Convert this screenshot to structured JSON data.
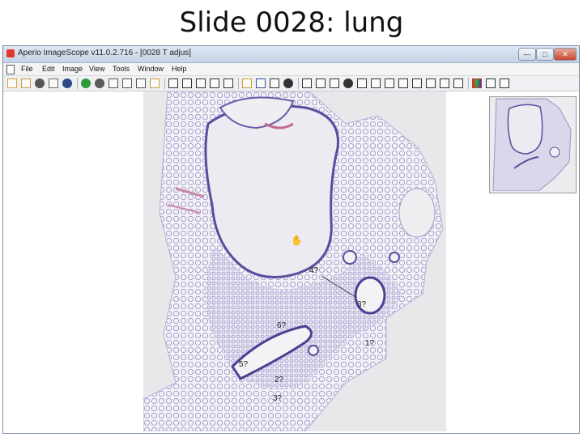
{
  "slide": {
    "title": "Slide 0028: lung"
  },
  "window": {
    "title": "Aperio ImageScope v11.0.2.716 - [0028 T adjus]",
    "buttons": {
      "minimize": "—",
      "maximize": "□",
      "close": "✕"
    }
  },
  "menu": {
    "items": [
      {
        "label": "File"
      },
      {
        "label": "Edit"
      },
      {
        "label": "Image"
      },
      {
        "label": "View"
      },
      {
        "label": "Tools"
      },
      {
        "label": "Window"
      },
      {
        "label": "Help"
      }
    ]
  },
  "toolbar": {
    "icons": [
      {
        "name": "open-folder-icon",
        "color": "#d9a63a"
      },
      {
        "name": "open-remote-icon",
        "color": "#c99a3a"
      },
      {
        "name": "camera-icon",
        "color": "#555555"
      },
      {
        "name": "print-icon",
        "color": "#666666"
      },
      {
        "name": "info-icon",
        "color": "#2b4a8a"
      },
      {
        "name": "go-back-icon",
        "color": "#2e9a3a"
      },
      {
        "name": "go-forward-icon",
        "color": "#5a5a5a"
      },
      {
        "name": "share-icon",
        "color": "#555555"
      },
      {
        "name": "link-icon",
        "color": "#555555"
      },
      {
        "name": "route-icon",
        "color": "#555555"
      },
      {
        "name": "select-region-icon",
        "color": "#c8a030"
      },
      {
        "name": "grid-view-icon",
        "color": "#333333"
      },
      {
        "name": "window-view-icon",
        "color": "#333333"
      },
      {
        "name": "layers-icon",
        "color": "#333333"
      },
      {
        "name": "zoom-icon",
        "color": "#333333"
      },
      {
        "name": "display-icon",
        "color": "#333333"
      },
      {
        "name": "annotation-edit-icon",
        "color": "#c8a030"
      },
      {
        "name": "analysis-icon",
        "color": "#335599"
      },
      {
        "name": "music-icon",
        "color": "#333333"
      },
      {
        "name": "magnify-icon",
        "color": "#333333"
      },
      {
        "name": "pan-hand-icon",
        "color": "#333333"
      },
      {
        "name": "region-tool-icon",
        "color": "#333333"
      },
      {
        "name": "measure-icon",
        "color": "#333333"
      },
      {
        "name": "camera-snap-icon",
        "color": "#333333"
      },
      {
        "name": "ruler-icon",
        "color": "#333333"
      },
      {
        "name": "pen-tool-icon",
        "color": "#333333"
      },
      {
        "name": "arrow-tool-icon",
        "color": "#333333"
      },
      {
        "name": "rectangle-tool-icon",
        "color": "#333333"
      },
      {
        "name": "ellipse-tool-icon",
        "color": "#333333"
      },
      {
        "name": "freehand-tool-icon",
        "color": "#333333"
      },
      {
        "name": "pointer-tool-icon",
        "color": "#333333"
      },
      {
        "name": "text-tool-icon",
        "color": "#333333"
      },
      {
        "name": "color-adjust-icon",
        "color": "#c8362e"
      },
      {
        "name": "overlay-icon",
        "color": "#333333"
      },
      {
        "name": "thumbnail-toggle-icon",
        "color": "#333333"
      }
    ]
  },
  "annotations": [
    {
      "label": "4?"
    },
    {
      "label": "3?"
    },
    {
      "label": "6?"
    },
    {
      "label": "1?"
    },
    {
      "label": "5?"
    },
    {
      "label": "2?"
    },
    {
      "label": "3?"
    }
  ],
  "colors": {
    "tissue_purple": "#6b5ea8",
    "tissue_pink": "#c98aa8",
    "background_gray": "#e9e7ea"
  }
}
